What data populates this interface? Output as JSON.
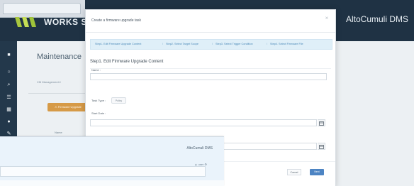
{
  "background_app": {
    "brand": "WORKS SY",
    "title": "AltoCumuli DMS",
    "user_label": "user",
    "page_title": "Maintenance",
    "breadcrumb": "CM Management ▾",
    "orange_button": "Firmware Upgrade",
    "table_label": "Name"
  },
  "overlay_window": {
    "title": "AltoCumuli DMS",
    "user_label": "user"
  },
  "modal": {
    "title": "Create a firmware upgrade task",
    "steps": [
      "Step1. Edit Firmware Upgrade Content",
      "Step2. Select Target Scope",
      "Step3. Select Trigger Condition",
      "Step4. Select Firmware File"
    ],
    "section_title": "Step1. Edit Firmware Upgrade Content",
    "fields": {
      "name_label": "Name :",
      "task_type_label": "Task Type :",
      "task_type_value": "Policy",
      "start_date_label": "Start Date :",
      "end_date_label": "End Date :"
    },
    "buttons": {
      "cancel": "Cancel",
      "next": "Next"
    }
  },
  "icons": {
    "close": "×",
    "calendar": "calendar-icon",
    "user": "user-icon",
    "settings": "settings-icon"
  },
  "colors": {
    "header": "#1f3244",
    "rail": "#23384b",
    "accent_blue": "#4d84c3",
    "steps_bg": "#dfeff8",
    "orange": "#d69a47"
  }
}
